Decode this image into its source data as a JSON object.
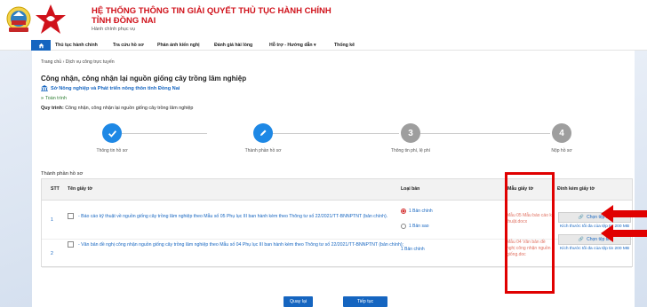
{
  "header": {
    "title_line1": "HỆ THỐNG THÔNG TIN GIẢI QUYẾT THỦ TỤC HÀNH CHÍNH",
    "title_line2": "TỈNH ĐỒNG NAI",
    "subtitle": "Hành chính phục vụ",
    "emblem_label": "Đồng Nai"
  },
  "nav": {
    "items": [
      "Thủ tục hành chính",
      "Tra cứu hồ sơ",
      "Phản ánh kiến nghị",
      "Đánh giá hài lòng",
      "Hỗ trợ - Hướng dẫn",
      "Thống kê"
    ]
  },
  "breadcrumb": {
    "home": "Trang chủ",
    "current": "Dịch vụ công trực tuyến"
  },
  "procedure": {
    "title": "Công nhận, công nhận lại nguồn giống cây trồng lâm nghiệp",
    "agency": "Sở Nông nghiệp và Phát triển nông thôn tỉnh Đồng Nai",
    "scope": "Toàn trình",
    "process_label": "Quy trình:",
    "process_value": "Công nhận, công nhận lại nguồn giống cây trồng lâm nghiệp"
  },
  "steps": [
    {
      "number": "1",
      "label": "Thông tin hồ sơ",
      "state": "done"
    },
    {
      "number": "2",
      "label": "Thành phần hồ sơ",
      "state": "current"
    },
    {
      "number": "3",
      "label": "Thông tin phí, lệ phí",
      "state": "pending"
    },
    {
      "number": "4",
      "label": "Nộp hồ sơ",
      "state": "pending"
    }
  ],
  "section_title": "Thành phần hồ sơ",
  "table": {
    "headers": [
      "STT",
      "Tên giấy tờ",
      "Loại bản",
      "Mẫu giấy tờ",
      "Đính kèm giấy tờ"
    ],
    "rows": [
      {
        "stt": "1",
        "name": "- Báo cáo kỹ thuật về nguồn giống cây trồng lâm nghiệp theo Mẫu số 05 Phụ lục III ban hành kèm theo Thông tư số 22/2021/TT-BNNPTNT (bản chính).",
        "options": [
          "1 Bản chính",
          "1 Bản sao"
        ],
        "template": "Mẫu 05 Mẫu báo cáo kỹ thuật.docx",
        "attach_label": "Chọn tệp tin",
        "size_note": "Kích thước tối đa của tệp tin 200 MB"
      },
      {
        "stt": "2",
        "name": "- Văn bản đề nghị công nhận nguồn giống cây trồng lâm nghiệp theo Mẫu số 04 Phụ lục III ban hành kèm theo Thông tư số 22/2021/TT-BNNPTNT (bản chính);",
        "options": [
          "1 Bản chính"
        ],
        "template": "Mẫu 04 Văn bản đề nghị công nhận nguồn giống.doc",
        "attach_label": "Chọn tệp tin",
        "size_note": "Kích thước tối đa của tệp tin 200 MB"
      }
    ]
  },
  "buttons": {
    "back": "Quay lại",
    "next": "Tiếp tục"
  },
  "colors": {
    "primary": "#1565c0",
    "brand_red": "#d0121b",
    "highlight": "#e00000",
    "step_active": "#1e88e5",
    "step_pending": "#9e9e9e"
  }
}
